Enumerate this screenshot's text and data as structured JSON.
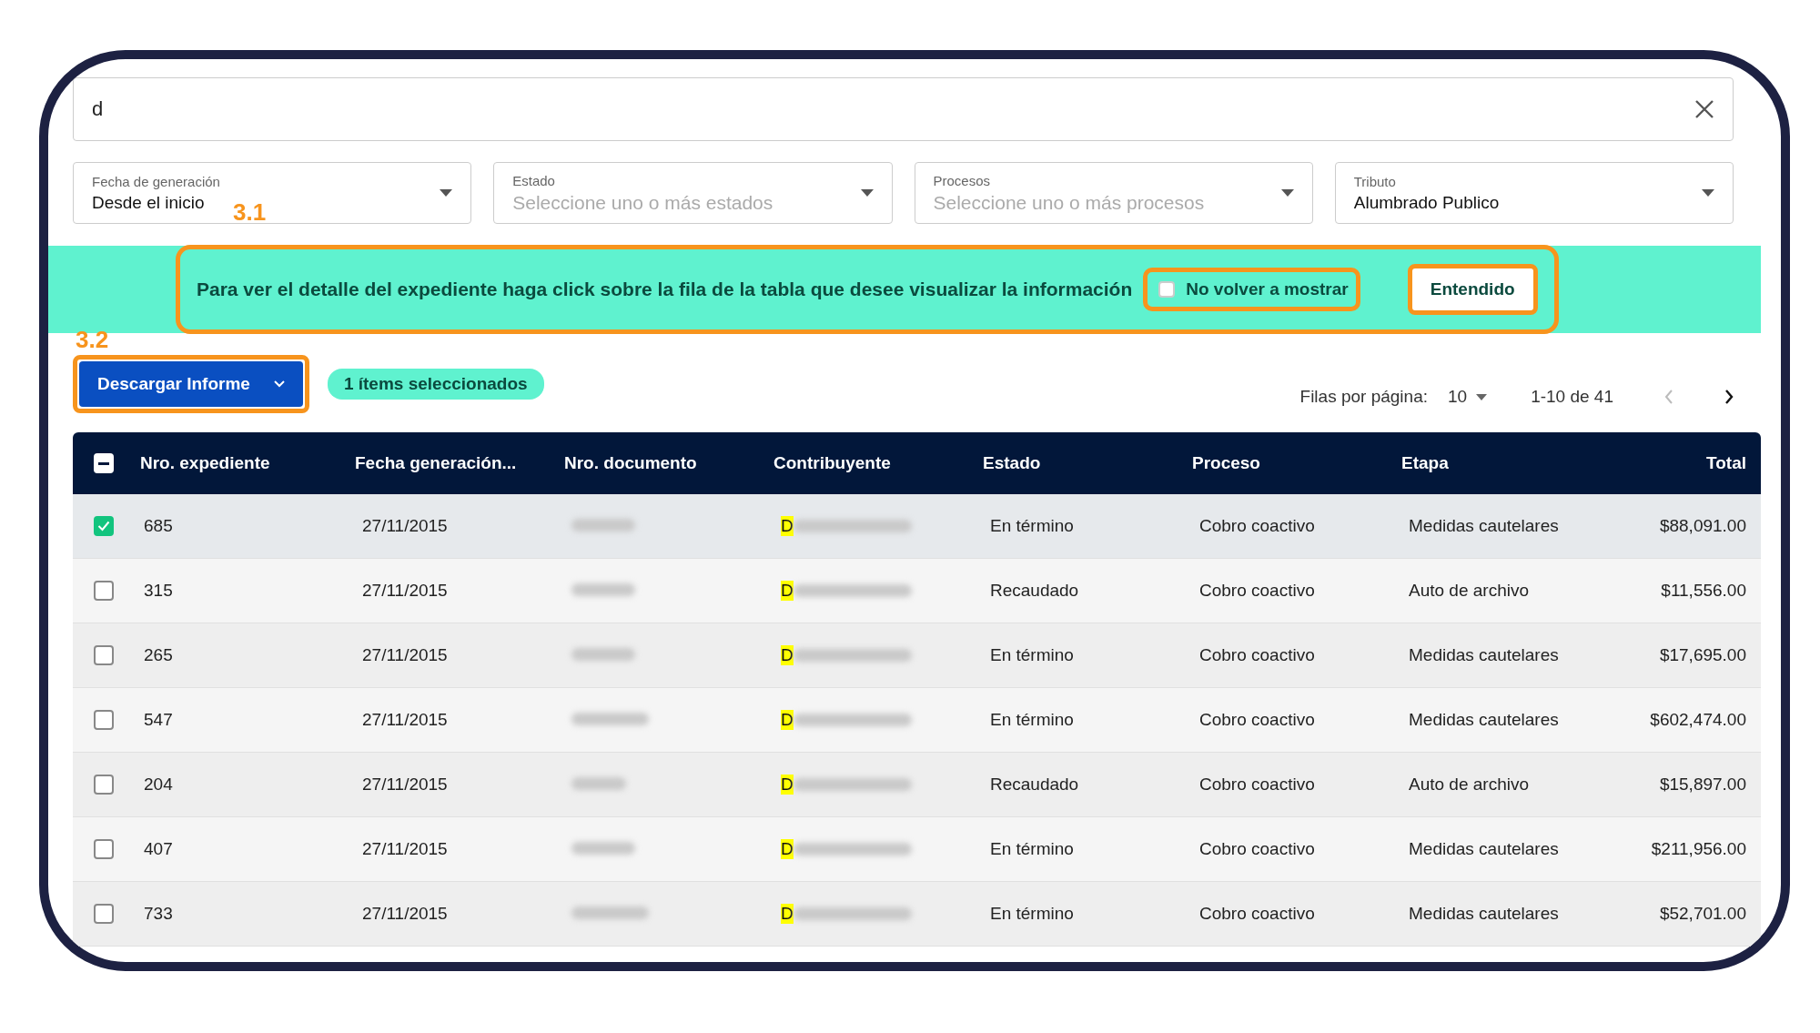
{
  "search": {
    "value": "d"
  },
  "filters": [
    {
      "label": "Fecha de generación",
      "value": "Desde el inicio"
    },
    {
      "label": "Estado",
      "placeholder": "Seleccione uno o más estados"
    },
    {
      "label": "Procesos",
      "placeholder": "Seleccione uno o más procesos"
    },
    {
      "label": "Tributo",
      "value": "Alumbrado Publico"
    }
  ],
  "annotations": [
    {
      "label": "3.1"
    },
    {
      "label": "3.2"
    }
  ],
  "banner": {
    "message": "Para ver el detalle del expediente haga click sobre la fila de la tabla que desee visualizar la información",
    "checkbox": {
      "label": "No volver a mostrar",
      "checked": false
    },
    "button": "Entendido"
  },
  "toolbar": {
    "download_button": "Descargar Informe",
    "selection_badge": "1 ítems seleccionados",
    "rows_per_page_label": "Filas por página:",
    "rows_per_page": "10",
    "range": "1-10 de 41"
  },
  "table": {
    "header_checkbox": {
      "indeterminate": true
    },
    "columns": [
      "Nro. expediente",
      "Fecha generación...",
      "Nro. documento",
      "Contribuyente",
      "Estado",
      "Proceso",
      "Etapa",
      "Total"
    ],
    "rows": [
      {
        "selected": true,
        "expediente": "685",
        "fecha": "27/11/2015",
        "contribuyente_match": "D",
        "estado": "En término",
        "proceso": "Cobro coactivo",
        "etapa": "Medidas cautelares",
        "total": "$88,091.00"
      },
      {
        "selected": false,
        "expediente": "315",
        "fecha": "27/11/2015",
        "contribuyente_match": "D",
        "estado": "Recaudado",
        "proceso": "Cobro coactivo",
        "etapa": "Auto de archivo",
        "total": "$11,556.00"
      },
      {
        "selected": false,
        "expediente": "265",
        "fecha": "27/11/2015",
        "contribuyente_match": "D",
        "estado": "En término",
        "proceso": "Cobro coactivo",
        "etapa": "Medidas cautelares",
        "total": "$17,695.00"
      },
      {
        "selected": false,
        "expediente": "547",
        "fecha": "27/11/2015",
        "contribuyente_match": "D",
        "estado": "En término",
        "proceso": "Cobro coactivo",
        "etapa": "Medidas cautelares",
        "total": "$602,474.00"
      },
      {
        "selected": false,
        "expediente": "204",
        "fecha": "27/11/2015",
        "contribuyente_match": "D",
        "estado": "Recaudado",
        "proceso": "Cobro coactivo",
        "etapa": "Auto de archivo",
        "total": "$15,897.00"
      },
      {
        "selected": false,
        "expediente": "407",
        "fecha": "27/11/2015",
        "contribuyente_match": "D",
        "estado": "En término",
        "proceso": "Cobro coactivo",
        "etapa": "Medidas cautelares",
        "total": "$211,956.00"
      },
      {
        "selected": false,
        "expediente": "733",
        "fecha": "27/11/2015",
        "contribuyente_match": "D",
        "estado": "En término",
        "proceso": "Cobro coactivo",
        "etapa": "Medidas cautelares",
        "total": "$52,701.00"
      }
    ]
  }
}
